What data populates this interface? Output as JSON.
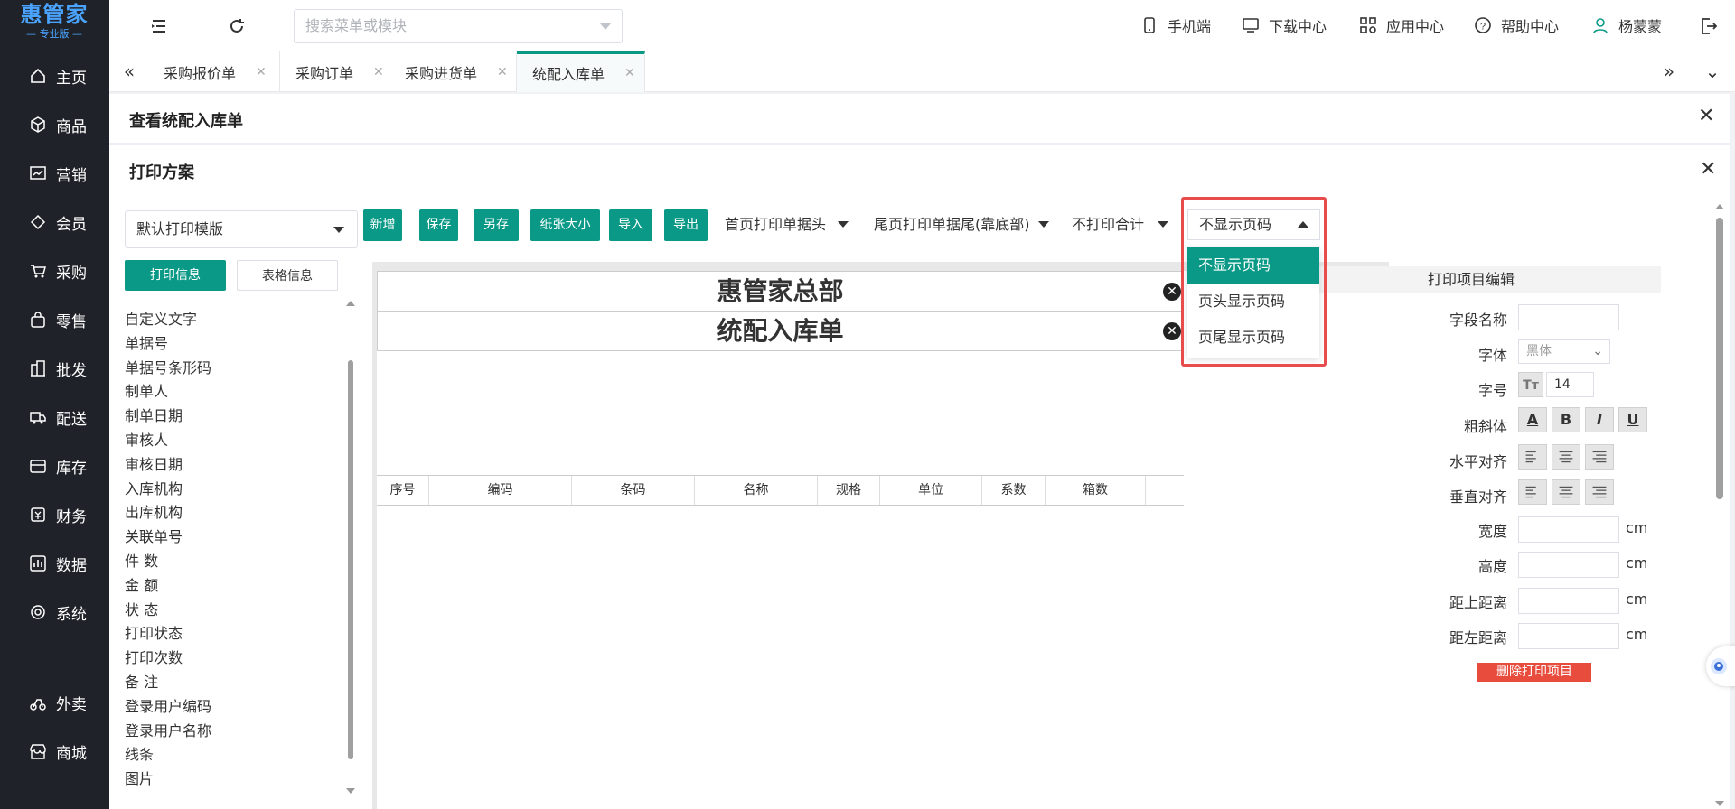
{
  "brand": {
    "name": "惠管家",
    "edition": "专业版",
    "color": "#4aa3ff"
  },
  "sidebar": {
    "items": [
      {
        "label": "主页",
        "icon": "home-icon"
      },
      {
        "label": "商品",
        "icon": "cube-icon"
      },
      {
        "label": "营销",
        "icon": "chart-icon"
      },
      {
        "label": "会员",
        "icon": "diamond-icon"
      },
      {
        "label": "采购",
        "icon": "cart-icon"
      },
      {
        "label": "零售",
        "icon": "bag-icon"
      },
      {
        "label": "批发",
        "icon": "building-icon"
      },
      {
        "label": "配送",
        "icon": "truck-icon"
      },
      {
        "label": "库存",
        "icon": "box-icon"
      },
      {
        "label": "财务",
        "icon": "money-icon"
      },
      {
        "label": "数据",
        "icon": "bar-chart-icon"
      },
      {
        "label": "系统",
        "icon": "settings-icon"
      },
      {
        "label": "外卖",
        "icon": "delivery-icon"
      },
      {
        "label": "商城",
        "icon": "shop-icon"
      }
    ]
  },
  "topbar": {
    "search_placeholder": "搜索菜单或模块",
    "mobile": "手机端",
    "download": "下载中心",
    "apps": "应用中心",
    "help": "帮助中心",
    "user": "杨蒙蒙"
  },
  "tabs": [
    {
      "label": "采购报价单",
      "active": false
    },
    {
      "label": "采购订单",
      "active": false
    },
    {
      "label": "采购进货单",
      "active": false
    },
    {
      "label": "统配入库单",
      "active": true
    }
  ],
  "panel": {
    "title": "查看统配入库单"
  },
  "print": {
    "title": "打印方案",
    "template_select": "默认打印模版",
    "buttons": {
      "add": "新增",
      "save": "保存",
      "save_as": "另存",
      "paper_size": "纸张大小",
      "import": "导入",
      "export": "导出"
    },
    "selects": {
      "first_page": "首页打印单据头",
      "last_page": "尾页打印单据尾(靠底部)",
      "total": "不打印合计",
      "page_code": "不显示页码"
    },
    "page_code_options": [
      "不显示页码",
      "页头显示页码",
      "页尾显示页码"
    ],
    "info_tabs": {
      "print_info": "打印信息",
      "table_info": "表格信息"
    },
    "fields": [
      "自定义文字",
      "单据号",
      "单据号条形码",
      "制单人",
      "制单日期",
      "审核人",
      "审核日期",
      "入库机构",
      "出库机构",
      "关联单号",
      "件 数",
      "金 额",
      "状 态",
      "打印状态",
      "打印次数",
      "备 注",
      "登录用户编码",
      "登录用户名称",
      "线条",
      "图片"
    ],
    "paper": {
      "title1": "惠管家总部",
      "title2": "统配入库单",
      "columns": [
        "序号",
        "编码",
        "条码",
        "名称",
        "规格",
        "单位",
        "系数",
        "箱数"
      ]
    },
    "editor": {
      "header": "打印项目编辑",
      "field_name": "字段名称",
      "font": "字体",
      "font_value": "黑体",
      "size": "字号",
      "size_value": "14",
      "style": "粗斜体",
      "h_align": "水平对齐",
      "v_align": "垂直对齐",
      "width": "宽度",
      "height": "高度",
      "top": "距上距离",
      "left": "距左距离",
      "unit": "cm",
      "delete": "删除打印项目",
      "style_buttons": [
        "A",
        "B",
        "I",
        "U"
      ]
    }
  },
  "colors": {
    "accent": "#0a9986",
    "highlight": "#e84c4c",
    "delete": "#e74c3c",
    "sidebar": "#1f2329"
  }
}
